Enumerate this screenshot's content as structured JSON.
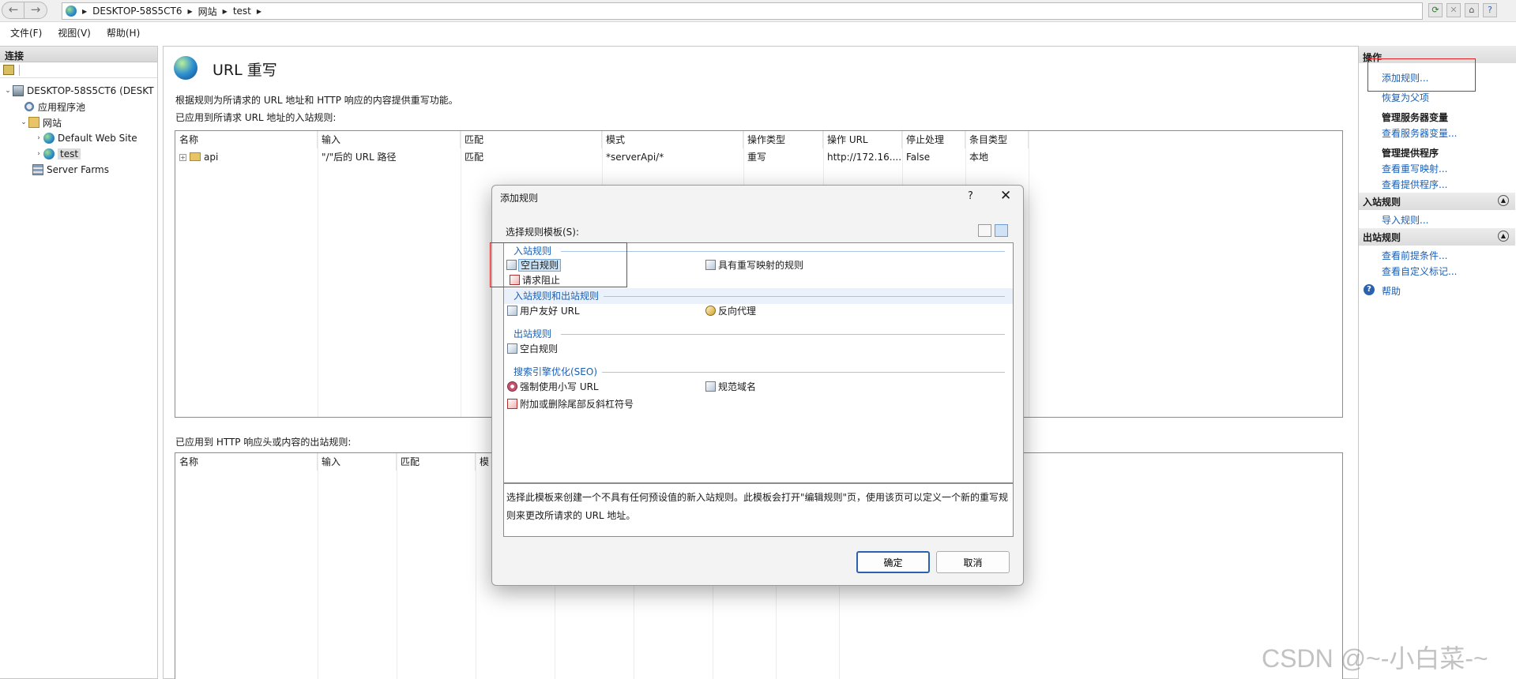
{
  "address_bar": {
    "breadcrumbs": [
      "DESKTOP-58S5CT6",
      "网站",
      "test"
    ]
  },
  "menu": [
    "文件(F)",
    "视图(V)",
    "帮助(H)"
  ],
  "connections": {
    "header": "连接",
    "tree": [
      {
        "label": "DESKTOP-58S5CT6 (DESKT",
        "level": 0,
        "expanded": true,
        "icon": "server-icon"
      },
      {
        "label": "应用程序池",
        "level": 1,
        "icon": "app-pool-icon"
      },
      {
        "label": "网站",
        "level": 1,
        "expanded": true,
        "icon": "sites-folder-icon"
      },
      {
        "label": "Default Web Site",
        "level": 2,
        "icon": "globe-icon"
      },
      {
        "label": "test",
        "level": 2,
        "icon": "globe-icon",
        "selected": true
      },
      {
        "label": "Server Farms",
        "level": 1,
        "icon": "server-farm-icon"
      }
    ]
  },
  "main": {
    "title": "URL 重写",
    "description": "根据规则为所请求的 URL 地址和 HTTP 响应的内容提供重写功能。",
    "inbound_label": "已应用到所请求 URL 地址的入站规则:",
    "inbound_columns": [
      "名称",
      "输入",
      "匹配",
      "模式",
      "操作类型",
      "操作 URL",
      "停止处理",
      "条目类型"
    ],
    "inbound_rows": [
      [
        "api",
        "\"/\"后的 URL 路径",
        "匹配",
        "*serverApi/*",
        "重写",
        "http://172.16....",
        "False",
        "本地"
      ]
    ],
    "outbound_label": "已应用到 HTTP 响应头或内容的出站规则:",
    "outbound_columns": [
      "名称",
      "输入",
      "匹配",
      "模"
    ]
  },
  "actions": {
    "header": "操作",
    "add_rule": "添加规则...",
    "revert": "恢复为父项",
    "server_vars_group": "管理服务器变量",
    "view_server_vars": "查看服务器变量...",
    "providers_group": "管理提供程序",
    "view_rewrite_maps": "查看重写映射...",
    "view_providers": "查看提供程序...",
    "inbound_section": "入站规则",
    "import_rules": "导入规则...",
    "outbound_section": "出站规则",
    "view_preconditions": "查看前提条件...",
    "view_custom_tags": "查看自定义标记...",
    "help": "帮助"
  },
  "dialog": {
    "title": "添加规则",
    "help_glyph": "?",
    "close_glyph": "✕",
    "select_label": "选择规则模板(S):",
    "sections": {
      "inbound": "入站规则",
      "inbound_outbound": "入站规则和出站规则",
      "outbound": "出站规则",
      "seo": "搜索引擎优化(SEO)"
    },
    "items": {
      "blank_rule": "空白规则",
      "rewrite_map_rule": "具有重写映射的规则",
      "request_blocking": "请求阻止",
      "user_friendly_url": "用户友好 URL",
      "reverse_proxy": "反向代理",
      "outbound_blank_rule": "空白规则",
      "enforce_lowercase": "强制使用小写 URL",
      "canonical_domain": "规范域名",
      "trailing_slash": "附加或删除尾部反斜杠符号"
    },
    "description_line1": "选择此模板来创建一个不具有任何预设值的新入站规则。此模板会打开\"编辑规则\"页，使用该页可以定义一个新的重写规",
    "description_line2": "则来更改所请求的 URL 地址。",
    "ok": "确定",
    "cancel": "取消"
  },
  "watermark": "CSDN @~-小白菜-~",
  "colors": {
    "link": "#1a5fb4",
    "annotation": "#e02020",
    "accent": "#2a62b0"
  }
}
